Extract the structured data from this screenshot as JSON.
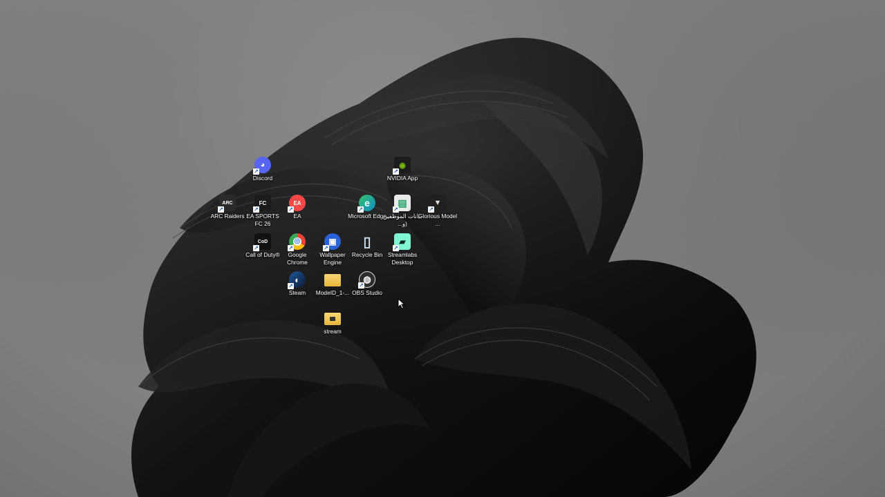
{
  "desktop": {
    "icons": [
      {
        "label": "Discord",
        "icon": "discord-icon",
        "color": "#5865f2"
      },
      {
        "label": "NVIDIA App",
        "icon": "nvidia-icon",
        "color": "#76b900"
      },
      {
        "label": "ARC Raiders",
        "icon": "arc-raiders-icon",
        "color": "#2b2b2b"
      },
      {
        "label": "EA SPORTS FC 26",
        "icon": "ea-sports-fc-icon",
        "color": "#1b1b1b"
      },
      {
        "label": "EA",
        "icon": "ea-icon",
        "color": "#ff4747"
      },
      {
        "label": "Microsoft Edge",
        "icon": "edge-icon",
        "color": "#0c8ec9"
      },
      {
        "label": "بيانات الموظفين (و...",
        "icon": "spreadsheet-icon",
        "color": "#21a366"
      },
      {
        "label": "Glorious Model ...",
        "icon": "glorious-mouse-icon",
        "color": "#202020"
      },
      {
        "label": "Call of Duty®",
        "icon": "call-of-duty-icon",
        "color": "#111111"
      },
      {
        "label": "Google Chrome",
        "icon": "chrome-icon",
        "color": "#ea4335"
      },
      {
        "label": "Wallpaper Engine",
        "icon": "wallpaper-engine-icon",
        "color": "#2a63d8"
      },
      {
        "label": "Recycle Bin",
        "icon": "recycle-bin-icon",
        "color": "#9fb8d4"
      },
      {
        "label": "Streamlabs Desktop",
        "icon": "streamlabs-icon",
        "color": "#80f5d2"
      },
      {
        "label": "Steam",
        "icon": "steam-icon",
        "color": "#1b3c73"
      },
      {
        "label": "ModeID_1-...",
        "icon": "folder-icon",
        "color": "#f2c14e"
      },
      {
        "label": "OBS Studio",
        "icon": "obs-icon",
        "color": "#3a3a3a"
      },
      {
        "label": "stream",
        "icon": "folder-icon",
        "color": "#f2c14e"
      }
    ]
  },
  "glyphs": {
    "discord": "◕",
    "nvidia": "◉",
    "arc": "ARC",
    "fc": "FC",
    "ea": "EA",
    "edge": "e",
    "sheet": "▤",
    "glorious": "▼",
    "cod": "CoD",
    "chrome": "◎",
    "wallpaper": "▣",
    "recycle": "▯",
    "streamlabs": "▰",
    "steam": "◐",
    "obs": "◍",
    "shortcut_arrow": "↗"
  }
}
